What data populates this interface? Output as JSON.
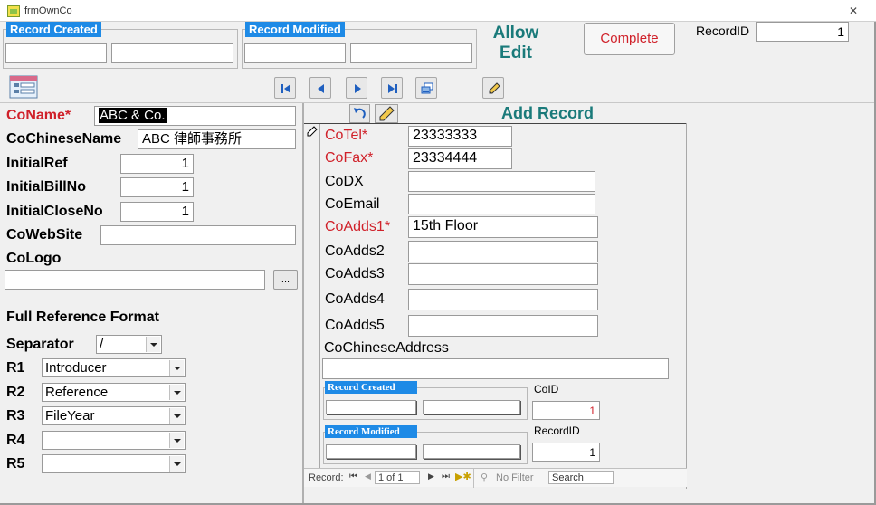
{
  "window": {
    "title": "frmOwnCo"
  },
  "header": {
    "record_created": "Record Created",
    "record_modified": "Record Modified",
    "allow_edit": "Allow Edit",
    "complete_button": "Complete",
    "record_id_label": "RecordID",
    "record_id_value": "1",
    "accent_color": "#1e8ae6",
    "edit_text_color": "#1a7a7a"
  },
  "toolbar": {
    "icons": [
      "form-icon",
      "first-record-icon",
      "previous-record-icon",
      "next-record-icon",
      "last-record-icon",
      "new-record-icon",
      "edit-pencil-icon"
    ]
  },
  "left": {
    "coname_label": "CoName*",
    "coname_value": "ABC & Co.",
    "cochinesename_label": "CoChineseName",
    "cochinesename_value": "ABC 律師事務所",
    "initialref_label": "InitialRef",
    "initialref_value": "1",
    "initialbillno_label": "InitialBillNo",
    "initialbillno_value": "1",
    "initialcloseno_label": "InitialCloseNo",
    "initialcloseno_value": "1",
    "cowebsite_label": "CoWebSite",
    "cowebsite_value": "",
    "cologo_label": "CoLogo",
    "cologo_value": "",
    "browse_button": "...",
    "full_ref_title": "Full Reference Format",
    "separator_label": "Separator",
    "separator_value": "/",
    "r1_label": "R1",
    "r1_value": "Introducer",
    "r2_label": "R2",
    "r2_value": "Reference",
    "r3_label": "R3",
    "r3_value": "FileYear",
    "r4_label": "R4",
    "r4_value": "",
    "r5_label": "R5",
    "r5_value": ""
  },
  "sub": {
    "title": "Add Record",
    "cotel_label": "CoTel*",
    "cotel_value": "23333333",
    "cofax_label": "CoFax*",
    "cofax_value": "23334444",
    "codx_label": "CoDX",
    "codx_value": "",
    "coemail_label": "CoEmail",
    "coemail_value": "",
    "coadds1_label": "CoAdds1*",
    "coadds1_value": "15th Floor",
    "coadds2_label": "CoAdds2",
    "coadds2_value": "",
    "coadds3_label": "CoAdds3",
    "coadds3_value": "",
    "coadds4_label": "CoAdds4",
    "coadds4_value": "",
    "coadds5_label": "CoAdds5",
    "coadds5_value": "",
    "cochineseaddress_label": "CoChineseAddress",
    "cochineseaddress_value": "",
    "record_created": "Record Created",
    "record_modified": "Record Modified",
    "coid_label": "CoID",
    "coid_value": "1",
    "recordid_label": "RecordID",
    "recordid_value": "1"
  },
  "navbar": {
    "record_label": "Record:",
    "position": "1 of 1",
    "filter": "No Filter",
    "search_placeholder": "Search"
  }
}
